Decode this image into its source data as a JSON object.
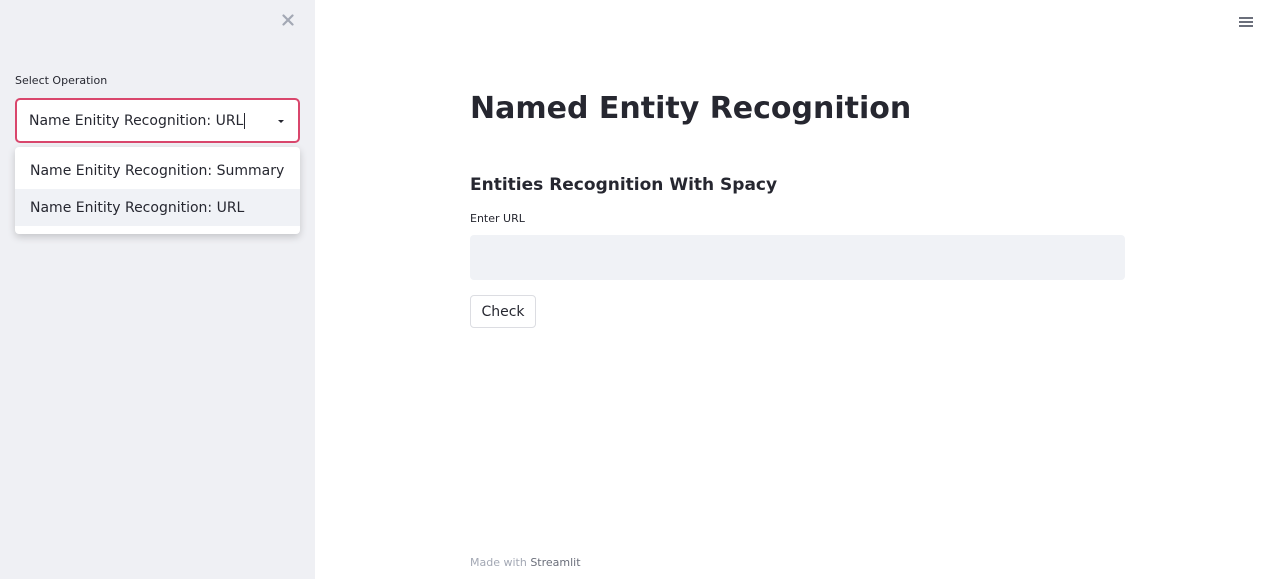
{
  "sidebar": {
    "select_label": "Select Operation",
    "select_value": "Name Enitity Recognition: URL",
    "options": [
      {
        "label": "Name Enitity Recognition: Summary"
      },
      {
        "label": "Name Enitity Recognition: URL"
      }
    ],
    "close_icon": "close-icon"
  },
  "main": {
    "title": "Named Entity Recognition",
    "subheader": "Entities Recognition With Spacy",
    "url_label": "Enter URL",
    "url_value": "",
    "check_label": "Check",
    "menu_icon": "hamburger-menu-icon"
  },
  "footer": {
    "prefix": "Made with ",
    "link": "Streamlit"
  },
  "colors": {
    "sidebar_bg": "#eff0f4",
    "select_border": "#d9466c",
    "input_bg": "#f0f2f6",
    "text": "#262730"
  }
}
